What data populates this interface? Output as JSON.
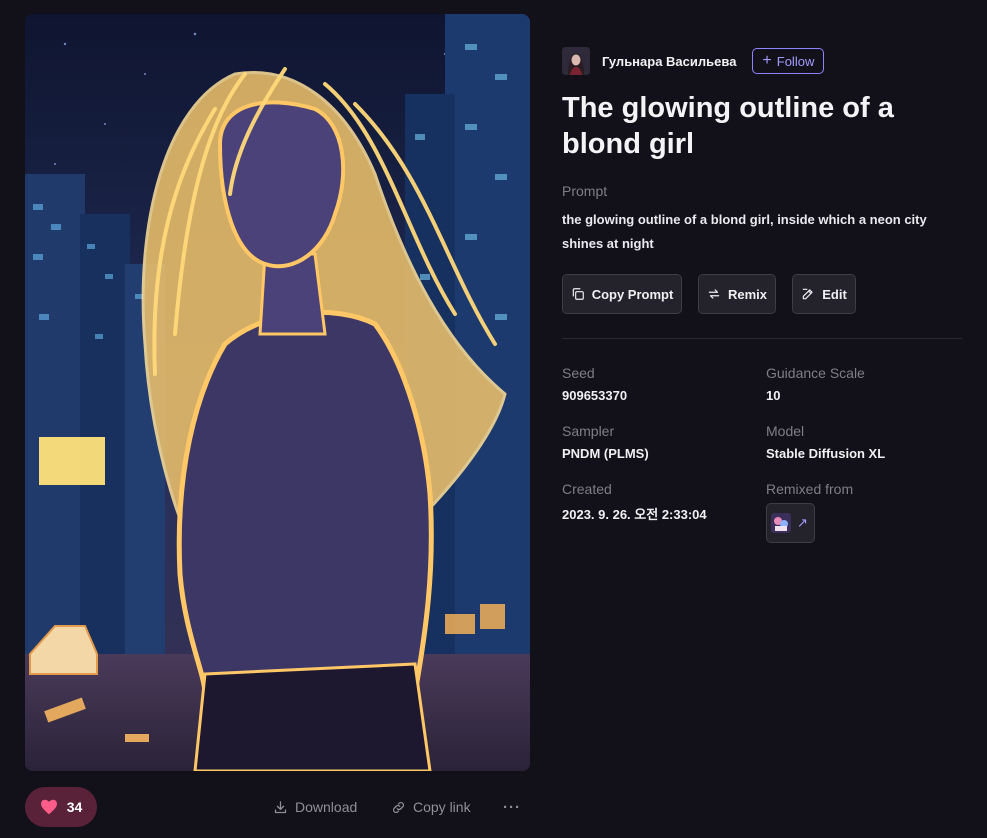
{
  "author": {
    "name": "Гульнара Васильева",
    "follow_label": "Follow"
  },
  "artwork": {
    "title": "The glowing outline of a blond girl"
  },
  "prompt": {
    "label": "Prompt",
    "text": "the glowing outline of a blond girl, inside which a neon city shines at night"
  },
  "actions": {
    "copy_prompt": "Copy Prompt",
    "remix": "Remix",
    "edit": "Edit"
  },
  "meta": {
    "seed_label": "Seed",
    "seed_value": "909653370",
    "guidance_label": "Guidance Scale",
    "guidance_value": "10",
    "sampler_label": "Sampler",
    "sampler_value": "PNDM (PLMS)",
    "model_label": "Model",
    "model_value": "Stable Diffusion XL",
    "created_label": "Created",
    "created_value": "2023. 9. 26. 오전 2:33:04",
    "remixed_from_label": "Remixed from"
  },
  "bottom_bar": {
    "like_count": "34",
    "download_label": "Download",
    "copy_link_label": "Copy link",
    "more_label": "···"
  },
  "icons": {
    "heart": "heart-icon",
    "download": "download-icon",
    "link": "link-icon",
    "more": "more-icon",
    "copy": "copy-icon",
    "remix": "remix-icon",
    "edit": "edit-icon",
    "plus": "plus-icon",
    "arrow": "arrow-up-right-icon"
  },
  "colors": {
    "background": "#121119",
    "accent": "#a29bff",
    "like_pill": "#5a2238",
    "heart": "#ff5c8a",
    "muted_text": "#7e7d89"
  }
}
